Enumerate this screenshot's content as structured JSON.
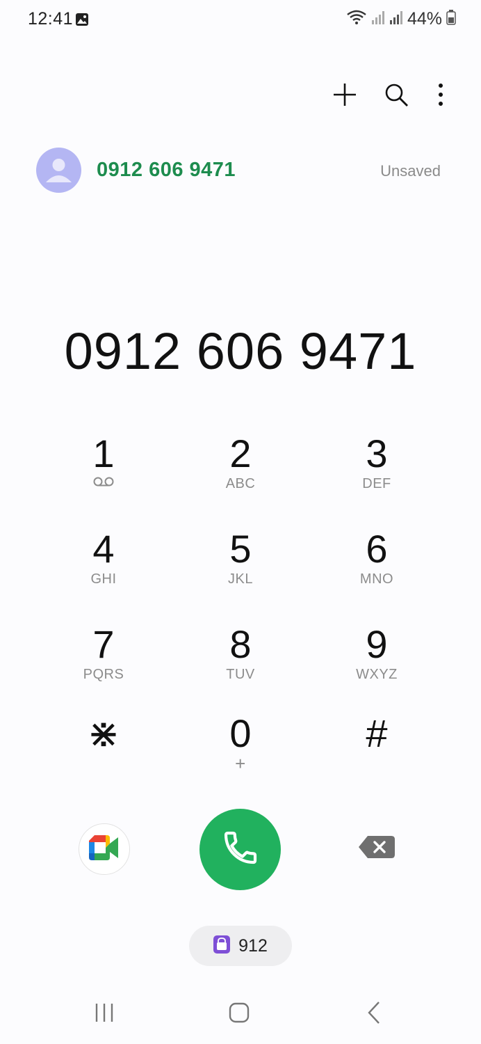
{
  "status_bar": {
    "time": "12:41",
    "battery_percent": "44%",
    "icons": [
      "image-icon",
      "wifi-icon",
      "signal-icon",
      "signal-icon",
      "battery-icon"
    ]
  },
  "toolbar": {
    "icons": [
      "plus-icon",
      "search-icon",
      "more-vert-icon"
    ]
  },
  "contact": {
    "number": "0912 606 9471",
    "status": "Unsaved",
    "avatar_color": "#b4b6f3",
    "number_color": "#1d8c4e"
  },
  "dialer": {
    "number": "0912 606 9471"
  },
  "keypad": {
    "keys": [
      {
        "digit": "1",
        "letters": ""
      },
      {
        "digit": "2",
        "letters": "ABC"
      },
      {
        "digit": "3",
        "letters": "DEF"
      },
      {
        "digit": "4",
        "letters": "GHI"
      },
      {
        "digit": "5",
        "letters": "JKL"
      },
      {
        "digit": "6",
        "letters": "MNO"
      },
      {
        "digit": "7",
        "letters": "PQRS"
      },
      {
        "digit": "8",
        "letters": "TUV"
      },
      {
        "digit": "9",
        "letters": "WXYZ"
      },
      {
        "digit": "⋇",
        "letters": ""
      },
      {
        "digit": "0",
        "letters": "+"
      },
      {
        "digit": "#",
        "letters": ""
      }
    ]
  },
  "actions": {
    "call_color": "#21b15e"
  },
  "suggestion_chip": {
    "label": "912",
    "icon_color": "#7e4fd6"
  },
  "nav_bar": {
    "icons": [
      "recents-icon",
      "home-icon",
      "back-icon"
    ]
  }
}
